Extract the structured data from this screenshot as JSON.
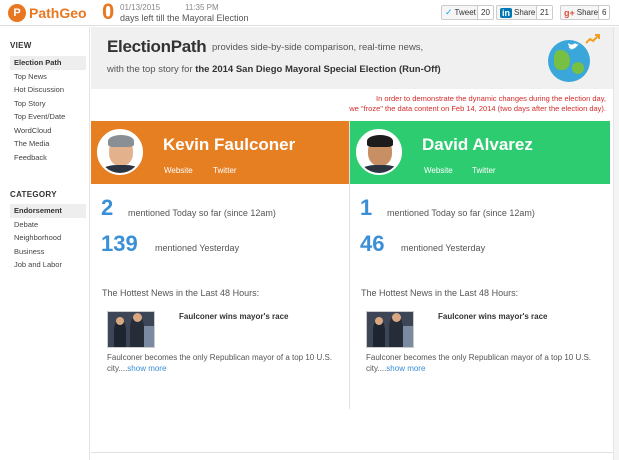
{
  "header": {
    "logo_letter": "P",
    "logo_text": "PathGeo",
    "countdown_days": "0",
    "date": "01/13/2015",
    "time": "11:35 PM",
    "countdown_text": "days left till the Mayoral Election"
  },
  "social": {
    "tweet_label": "Tweet",
    "tweet_count": "20",
    "linkedin_icon": "in",
    "share_label": "Share",
    "share_count": "21",
    "gplus_icon": "g+",
    "gplus_label": "Share",
    "gplus_count": "6"
  },
  "sidebar": {
    "view_heading": "VIEW",
    "view_items": [
      "Election Path",
      "Top News",
      "Hot Discussion",
      "Top Story",
      "Top Event/Date",
      "WordCloud",
      "The Media",
      "Feedback"
    ],
    "view_active_index": 0,
    "category_heading": "CATEGORY",
    "category_items": [
      "Endorsement",
      "Debate",
      "Neighborhood",
      "Business",
      "Job and Labor"
    ],
    "category_active_index": 0
  },
  "banner": {
    "title": "ElectionPath",
    "line1": "provides side-by-side comparison, real-time news,",
    "line2_prefix": "with the top story for",
    "line2_bold": "the 2014 San Diego Mayoral Special Election (Run-Off)"
  },
  "notice": {
    "line1": "In order to demonstrate the dynamic changes during the election day,",
    "line2": "we \"froze\" the data content on Feb 14, 2014 (two days after the election day)."
  },
  "candidates": [
    {
      "name": "Kevin Faulconer",
      "website_label": "Website",
      "twitter_label": "Twitter",
      "today_count": "2",
      "today_label": "mentioned Today so far (since 12am)",
      "yesterday_count": "139",
      "yesterday_label": "mentioned Yesterday",
      "hottest_title": "The Hottest News in the Last 48 Hours:",
      "news_headline": "Faulconer wins mayor's race",
      "news_body": "Faulconer becomes the only Republican mayor of a top 10 U.S. city....",
      "show_more": "show more",
      "color": "#e67e22"
    },
    {
      "name": "David Alvarez",
      "website_label": "Website",
      "twitter_label": "Twitter",
      "today_count": "1",
      "today_label": "mentioned Today so far (since 12am)",
      "yesterday_count": "46",
      "yesterday_label": "mentioned Yesterday",
      "hottest_title": "The Hottest News in the Last 48 Hours:",
      "news_headline": "Faulconer wins mayor's race",
      "news_body": "Faulconer becomes the only Republican mayor of a top 10 U.S. city....",
      "show_more": "show more",
      "color": "#2ecc71"
    }
  ],
  "colors": {
    "accent": "#e87722",
    "count_blue": "#3a8fd6",
    "notice_red": "#d62b2b"
  },
  "icons": [
    "pathgeo-logo-icon",
    "twitter-icon",
    "linkedin-icon",
    "gplus-icon",
    "globe-icon",
    "twitter-bird-icon",
    "trend-icon"
  ]
}
